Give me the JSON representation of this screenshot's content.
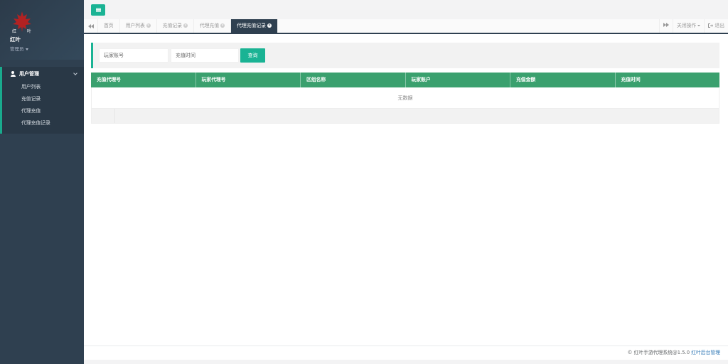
{
  "sidebar": {
    "user_name": "红叶",
    "user_role": "管理员",
    "group": {
      "label": "用户管理",
      "items": [
        {
          "label": "用户列表"
        },
        {
          "label": "充值记录"
        },
        {
          "label": "代理充值"
        },
        {
          "label": "代理充值记录"
        }
      ]
    }
  },
  "tabs": {
    "items": [
      {
        "label": "首页",
        "closable": false
      },
      {
        "label": "用户列表",
        "closable": true
      },
      {
        "label": "充值记录",
        "closable": true
      },
      {
        "label": "代理充值",
        "closable": true
      },
      {
        "label": "代理充值记录",
        "closable": true,
        "active": true
      }
    ],
    "close_ops_label": "关闭操作",
    "logout_label": "退出"
  },
  "search": {
    "account_placeholder": "玩家账号",
    "time_placeholder": "充值时间",
    "button_label": "查询"
  },
  "table": {
    "columns": [
      "充值代理号",
      "玩家代理号",
      "区组名称",
      "玩家账户",
      "充值金额",
      "充值时间"
    ],
    "empty_text": "无数据"
  },
  "footer": {
    "text": "© 红叶手游代理系统@1.5.0",
    "link_text": "红叶后台管理"
  },
  "colors": {
    "sidebar_bg": "#2f4050",
    "accent": "#1ab394",
    "table_header": "#3aa06e",
    "logo_red": "#c0392b"
  }
}
